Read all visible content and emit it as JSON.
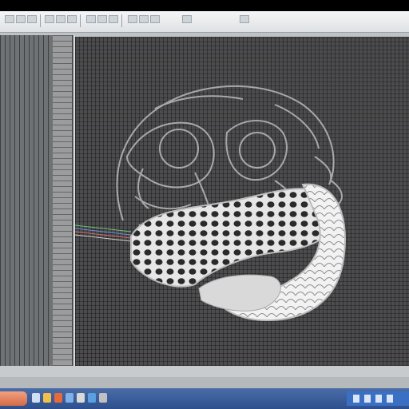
{
  "toolbar": {
    "buttons": [
      "new-icon",
      "open-icon",
      "save-icon",
      "print-icon",
      "undo-icon",
      "redo-icon",
      "cut-icon",
      "copy-icon",
      "paste-icon",
      "zoom-icon",
      "pan-icon",
      "rotate-icon",
      "select-icon",
      "render-icon"
    ]
  },
  "viewport": {
    "background": "#4c4c4e",
    "model_outline_color": "#a8a8a8",
    "model_surface_color": "#e6e6e6",
    "model_hole_color": "#2a2a2a"
  },
  "taskbar": {
    "start_color": "#e07f5a",
    "bar_color": "#2f5394",
    "tray_color": "#3a6fc4"
  }
}
